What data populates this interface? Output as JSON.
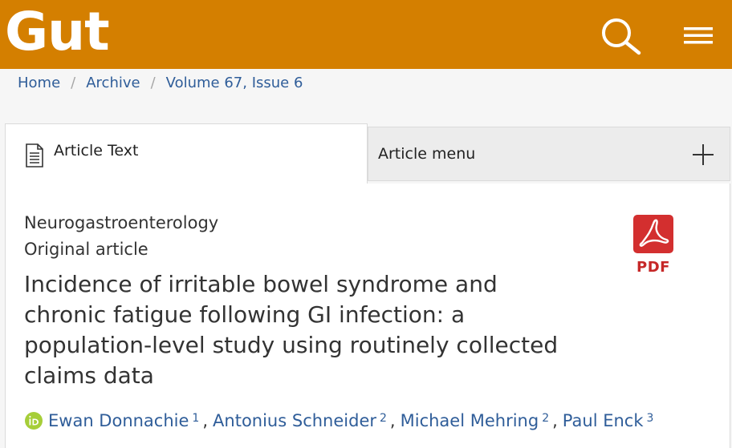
{
  "header": {
    "logo": "Gut",
    "brand_color": "#d47f00"
  },
  "icons": {
    "search": "search-icon",
    "menu": "hamburger-menu-icon",
    "document": "document-icon",
    "plus": "plus-icon",
    "pdf": "adobe-pdf-icon",
    "orcid": "orcid-icon"
  },
  "breadcrumb": {
    "items": [
      "Home",
      "Archive",
      "Volume 67, Issue 6"
    ],
    "separator": "/"
  },
  "tabs": {
    "article_text": "Article Text",
    "article_menu": "Article menu"
  },
  "article": {
    "section": "Neurogastroenterology",
    "type": "Original article",
    "title": "Incidence of irritable bowel syndrome and chronic fatigue following GI infection: a population-level study using routinely collected claims data",
    "pdf_label": "PDF",
    "authors": [
      {
        "name": "Ewan Donnachie",
        "affiliation": "1"
      },
      {
        "name": "Antonius Schneider",
        "affiliation": "2"
      },
      {
        "name": "Michael Mehring",
        "affiliation": "2"
      },
      {
        "name": "Paul Enck",
        "affiliation": "3"
      }
    ]
  },
  "colors": {
    "link": "#2f5d99",
    "pdf_red": "#d32f2f",
    "orcid_green": "#a6ce39"
  }
}
